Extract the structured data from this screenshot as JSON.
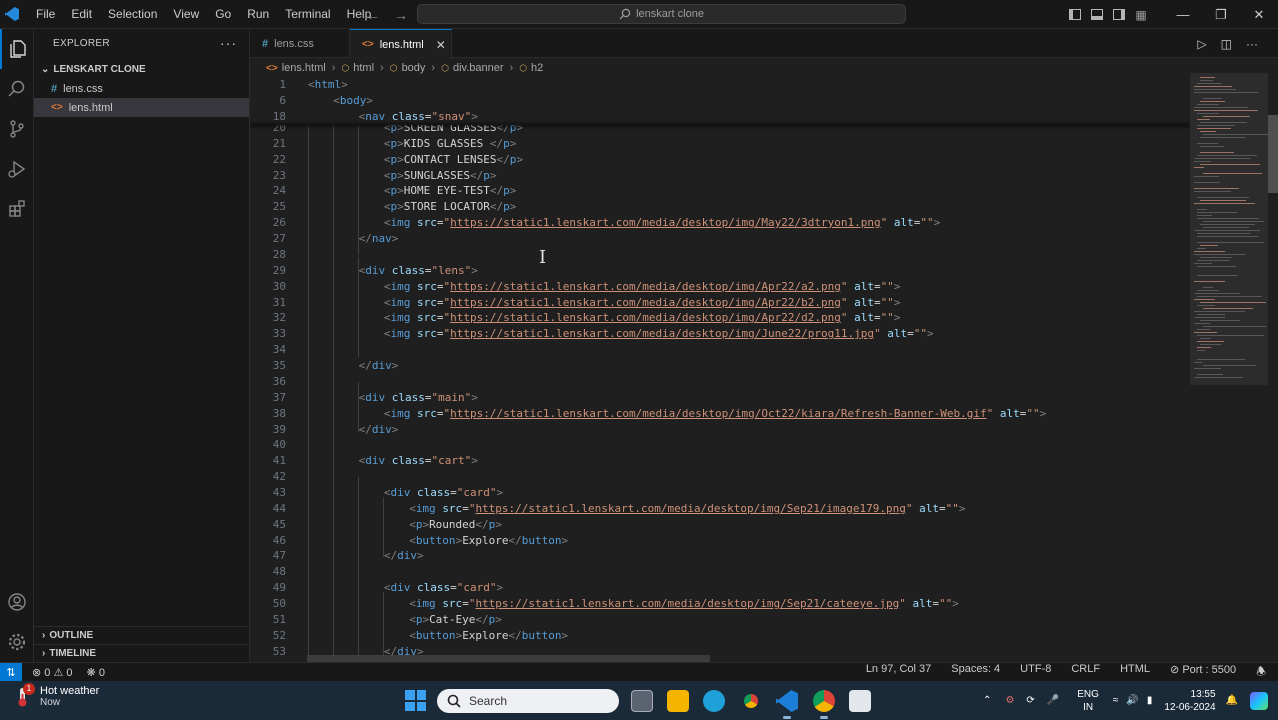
{
  "titlebar": {
    "menu": [
      "File",
      "Edit",
      "Selection",
      "View",
      "Go",
      "Run",
      "Terminal",
      "Help"
    ],
    "search_text": "lenskart clone"
  },
  "sidebar": {
    "title": "EXPLORER",
    "folder": "LENSKART CLONE",
    "files": [
      "lens.css",
      "lens.html"
    ],
    "outline": "OUTLINE",
    "timeline": "TIMELINE"
  },
  "tabs": [
    {
      "label": "lens.css",
      "icon": "css-file-icon"
    },
    {
      "label": "lens.html",
      "icon": "html-file-icon"
    }
  ],
  "breadcrumb": [
    "lens.html",
    "html",
    "body",
    "div.banner",
    "h2"
  ],
  "code_lines": [
    {
      "n": "1",
      "indent": 0,
      "parts": [
        [
          "b",
          "<"
        ],
        [
          "t",
          "html"
        ],
        [
          "b",
          ">"
        ]
      ]
    },
    {
      "n": "6",
      "indent": 1,
      "parts": [
        [
          "b",
          "<"
        ],
        [
          "t",
          "body"
        ],
        [
          "b",
          ">"
        ]
      ]
    },
    {
      "n": "18",
      "indent": 2,
      "parts": [
        [
          "b",
          "<"
        ],
        [
          "t",
          "nav"
        ],
        [
          "tx",
          " "
        ],
        [
          "a",
          "class"
        ],
        [
          "tx",
          "="
        ],
        [
          "s",
          "\"snav\""
        ],
        [
          "b",
          ">"
        ]
      ]
    },
    {
      "n": "20",
      "indent": 3,
      "parts": [
        [
          "b",
          "<"
        ],
        [
          "t",
          "p"
        ],
        [
          "b",
          ">"
        ],
        [
          "tx",
          "SCREEN GLASSES"
        ],
        [
          "b",
          "</"
        ],
        [
          "t",
          "p"
        ],
        [
          "b",
          ">"
        ]
      ]
    },
    {
      "n": "21",
      "indent": 3,
      "parts": [
        [
          "b",
          "<"
        ],
        [
          "t",
          "p"
        ],
        [
          "b",
          ">"
        ],
        [
          "tx",
          "KIDS GLASSES "
        ],
        [
          "b",
          "</"
        ],
        [
          "t",
          "p"
        ],
        [
          "b",
          ">"
        ]
      ]
    },
    {
      "n": "22",
      "indent": 3,
      "parts": [
        [
          "b",
          "<"
        ],
        [
          "t",
          "p"
        ],
        [
          "b",
          ">"
        ],
        [
          "tx",
          "CONTACT LENSES"
        ],
        [
          "b",
          "</"
        ],
        [
          "t",
          "p"
        ],
        [
          "b",
          ">"
        ]
      ]
    },
    {
      "n": "23",
      "indent": 3,
      "parts": [
        [
          "b",
          "<"
        ],
        [
          "t",
          "p"
        ],
        [
          "b",
          ">"
        ],
        [
          "tx",
          "SUNGLASSES"
        ],
        [
          "b",
          "</"
        ],
        [
          "t",
          "p"
        ],
        [
          "b",
          ">"
        ]
      ]
    },
    {
      "n": "24",
      "indent": 3,
      "parts": [
        [
          "b",
          "<"
        ],
        [
          "t",
          "p"
        ],
        [
          "b",
          ">"
        ],
        [
          "tx",
          "HOME EYE-TEST"
        ],
        [
          "b",
          "</"
        ],
        [
          "t",
          "p"
        ],
        [
          "b",
          ">"
        ]
      ]
    },
    {
      "n": "25",
      "indent": 3,
      "parts": [
        [
          "b",
          "<"
        ],
        [
          "t",
          "p"
        ],
        [
          "b",
          ">"
        ],
        [
          "tx",
          "STORE LOCATOR"
        ],
        [
          "b",
          "</"
        ],
        [
          "t",
          "p"
        ],
        [
          "b",
          ">"
        ]
      ]
    },
    {
      "n": "26",
      "indent": 3,
      "parts": [
        [
          "b",
          "<"
        ],
        [
          "t",
          "img"
        ],
        [
          "tx",
          " "
        ],
        [
          "a",
          "src"
        ],
        [
          "tx",
          "="
        ],
        [
          "s",
          "\""
        ],
        [
          "u",
          "https://static1.lenskart.com/media/desktop/img/May22/3dtryon1.png"
        ],
        [
          "s",
          "\""
        ],
        [
          "tx",
          " "
        ],
        [
          "a",
          "alt"
        ],
        [
          "tx",
          "="
        ],
        [
          "s",
          "\"\""
        ],
        [
          "b",
          ">"
        ]
      ]
    },
    {
      "n": "27",
      "indent": 2,
      "parts": [
        [
          "b",
          "</"
        ],
        [
          "t",
          "nav"
        ],
        [
          "b",
          ">"
        ]
      ]
    },
    {
      "n": "28",
      "indent": 0,
      "parts": []
    },
    {
      "n": "29",
      "indent": 2,
      "parts": [
        [
          "b",
          "<"
        ],
        [
          "t",
          "div"
        ],
        [
          "tx",
          " "
        ],
        [
          "a",
          "class"
        ],
        [
          "tx",
          "="
        ],
        [
          "s",
          "\"lens\""
        ],
        [
          "b",
          ">"
        ]
      ]
    },
    {
      "n": "30",
      "indent": 3,
      "parts": [
        [
          "b",
          "<"
        ],
        [
          "t",
          "img"
        ],
        [
          "tx",
          " "
        ],
        [
          "a",
          "src"
        ],
        [
          "tx",
          "="
        ],
        [
          "s",
          "\""
        ],
        [
          "u",
          "https://static1.lenskart.com/media/desktop/img/Apr22/a2.png"
        ],
        [
          "s",
          "\""
        ],
        [
          "tx",
          " "
        ],
        [
          "a",
          "alt"
        ],
        [
          "tx",
          "="
        ],
        [
          "s",
          "\"\""
        ],
        [
          "b",
          ">"
        ]
      ]
    },
    {
      "n": "31",
      "indent": 3,
      "parts": [
        [
          "b",
          "<"
        ],
        [
          "t",
          "img"
        ],
        [
          "tx",
          " "
        ],
        [
          "a",
          "src"
        ],
        [
          "tx",
          "="
        ],
        [
          "s",
          "\""
        ],
        [
          "u",
          "https://static1.lenskart.com/media/desktop/img/Apr22/b2.png"
        ],
        [
          "s",
          "\""
        ],
        [
          "tx",
          " "
        ],
        [
          "a",
          "alt"
        ],
        [
          "tx",
          "="
        ],
        [
          "s",
          "\"\""
        ],
        [
          "b",
          ">"
        ]
      ]
    },
    {
      "n": "32",
      "indent": 3,
      "parts": [
        [
          "b",
          "<"
        ],
        [
          "t",
          "img"
        ],
        [
          "tx",
          " "
        ],
        [
          "a",
          "src"
        ],
        [
          "tx",
          "="
        ],
        [
          "s",
          "\""
        ],
        [
          "u",
          "https://static1.lenskart.com/media/desktop/img/Apr22/d2.png"
        ],
        [
          "s",
          "\""
        ],
        [
          "tx",
          " "
        ],
        [
          "a",
          "alt"
        ],
        [
          "tx",
          "="
        ],
        [
          "s",
          "\"\""
        ],
        [
          "b",
          ">"
        ]
      ]
    },
    {
      "n": "33",
      "indent": 3,
      "parts": [
        [
          "b",
          "<"
        ],
        [
          "t",
          "img"
        ],
        [
          "tx",
          " "
        ],
        [
          "a",
          "src"
        ],
        [
          "tx",
          "="
        ],
        [
          "s",
          "\""
        ],
        [
          "u",
          "https://static1.lenskart.com/media/desktop/img/June22/prog11.jpg"
        ],
        [
          "s",
          "\""
        ],
        [
          "tx",
          " "
        ],
        [
          "a",
          "alt"
        ],
        [
          "tx",
          "="
        ],
        [
          "s",
          "\"\""
        ],
        [
          "b",
          ">"
        ]
      ]
    },
    {
      "n": "34",
      "indent": 0,
      "parts": []
    },
    {
      "n": "35",
      "indent": 2,
      "parts": [
        [
          "b",
          "</"
        ],
        [
          "t",
          "div"
        ],
        [
          "b",
          ">"
        ]
      ]
    },
    {
      "n": "36",
      "indent": 0,
      "parts": []
    },
    {
      "n": "37",
      "indent": 2,
      "parts": [
        [
          "b",
          "<"
        ],
        [
          "t",
          "div"
        ],
        [
          "tx",
          " "
        ],
        [
          "a",
          "class"
        ],
        [
          "tx",
          "="
        ],
        [
          "s",
          "\"main\""
        ],
        [
          "b",
          ">"
        ]
      ]
    },
    {
      "n": "38",
      "indent": 3,
      "parts": [
        [
          "b",
          "<"
        ],
        [
          "t",
          "img"
        ],
        [
          "tx",
          " "
        ],
        [
          "a",
          "src"
        ],
        [
          "tx",
          "="
        ],
        [
          "s",
          "\""
        ],
        [
          "u",
          "https://static1.lenskart.com/media/desktop/img/Oct22/kiara/Refresh-Banner-Web.gif"
        ],
        [
          "s",
          "\""
        ],
        [
          "tx",
          " "
        ],
        [
          "a",
          "alt"
        ],
        [
          "tx",
          "="
        ],
        [
          "s",
          "\"\""
        ],
        [
          "b",
          ">"
        ]
      ]
    },
    {
      "n": "39",
      "indent": 2,
      "parts": [
        [
          "b",
          "</"
        ],
        [
          "t",
          "div"
        ],
        [
          "b",
          ">"
        ]
      ]
    },
    {
      "n": "40",
      "indent": 0,
      "parts": []
    },
    {
      "n": "41",
      "indent": 2,
      "parts": [
        [
          "b",
          "<"
        ],
        [
          "t",
          "div"
        ],
        [
          "tx",
          " "
        ],
        [
          "a",
          "class"
        ],
        [
          "tx",
          "="
        ],
        [
          "s",
          "\"cart\""
        ],
        [
          "b",
          ">"
        ]
      ]
    },
    {
      "n": "42",
      "indent": 0,
      "parts": []
    },
    {
      "n": "43",
      "indent": 3,
      "parts": [
        [
          "b",
          "<"
        ],
        [
          "t",
          "div"
        ],
        [
          "tx",
          " "
        ],
        [
          "a",
          "class"
        ],
        [
          "tx",
          "="
        ],
        [
          "s",
          "\"card\""
        ],
        [
          "b",
          ">"
        ]
      ]
    },
    {
      "n": "44",
      "indent": 4,
      "parts": [
        [
          "b",
          "<"
        ],
        [
          "t",
          "img"
        ],
        [
          "tx",
          " "
        ],
        [
          "a",
          "src"
        ],
        [
          "tx",
          "="
        ],
        [
          "s",
          "\""
        ],
        [
          "u",
          "https://static1.lenskart.com/media/desktop/img/Sep21/image179.png"
        ],
        [
          "s",
          "\""
        ],
        [
          "tx",
          " "
        ],
        [
          "a",
          "alt"
        ],
        [
          "tx",
          "="
        ],
        [
          "s",
          "\"\""
        ],
        [
          "b",
          ">"
        ]
      ]
    },
    {
      "n": "45",
      "indent": 4,
      "parts": [
        [
          "b",
          "<"
        ],
        [
          "t",
          "p"
        ],
        [
          "b",
          ">"
        ],
        [
          "tx",
          "Rounded"
        ],
        [
          "b",
          "</"
        ],
        [
          "t",
          "p"
        ],
        [
          "b",
          ">"
        ]
      ]
    },
    {
      "n": "46",
      "indent": 4,
      "parts": [
        [
          "b",
          "<"
        ],
        [
          "t",
          "button"
        ],
        [
          "b",
          ">"
        ],
        [
          "tx",
          "Explore"
        ],
        [
          "b",
          "</"
        ],
        [
          "t",
          "button"
        ],
        [
          "b",
          ">"
        ]
      ]
    },
    {
      "n": "47",
      "indent": 3,
      "parts": [
        [
          "b",
          "</"
        ],
        [
          "t",
          "div"
        ],
        [
          "b",
          ">"
        ]
      ]
    },
    {
      "n": "48",
      "indent": 0,
      "parts": []
    },
    {
      "n": "49",
      "indent": 3,
      "parts": [
        [
          "b",
          "<"
        ],
        [
          "t",
          "div"
        ],
        [
          "tx",
          " "
        ],
        [
          "a",
          "class"
        ],
        [
          "tx",
          "="
        ],
        [
          "s",
          "\"card\""
        ],
        [
          "b",
          ">"
        ]
      ]
    },
    {
      "n": "50",
      "indent": 4,
      "parts": [
        [
          "b",
          "<"
        ],
        [
          "t",
          "img"
        ],
        [
          "tx",
          " "
        ],
        [
          "a",
          "src"
        ],
        [
          "tx",
          "="
        ],
        [
          "s",
          "\""
        ],
        [
          "u",
          "https://static1.lenskart.com/media/desktop/img/Sep21/cateeye.jpg"
        ],
        [
          "s",
          "\""
        ],
        [
          "tx",
          " "
        ],
        [
          "a",
          "alt"
        ],
        [
          "tx",
          "="
        ],
        [
          "s",
          "\"\""
        ],
        [
          "b",
          ">"
        ]
      ]
    },
    {
      "n": "51",
      "indent": 4,
      "parts": [
        [
          "b",
          "<"
        ],
        [
          "t",
          "p"
        ],
        [
          "b",
          ">"
        ],
        [
          "tx",
          "Cat-Eye"
        ],
        [
          "b",
          "</"
        ],
        [
          "t",
          "p"
        ],
        [
          "b",
          ">"
        ]
      ]
    },
    {
      "n": "52",
      "indent": 4,
      "parts": [
        [
          "b",
          "<"
        ],
        [
          "t",
          "button"
        ],
        [
          "b",
          ">"
        ],
        [
          "tx",
          "Explore"
        ],
        [
          "b",
          "</"
        ],
        [
          "t",
          "button"
        ],
        [
          "b",
          ">"
        ]
      ]
    },
    {
      "n": "53",
      "indent": 3,
      "parts": [
        [
          "b",
          "</"
        ],
        [
          "t",
          "div"
        ],
        [
          "b",
          ">"
        ]
      ]
    }
  ],
  "status": {
    "errors": "0",
    "warnings": "0",
    "ports": "0",
    "position": "Ln 97, Col 37",
    "spaces": "Spaces: 4",
    "encoding": "UTF-8",
    "eol": "CRLF",
    "language": "HTML",
    "port": "Port : 5500"
  },
  "taskbar": {
    "weather_title": "Hot weather",
    "weather_sub": "Now",
    "weather_badge": "1",
    "search_placeholder": "Search",
    "lang_line1": "ENG",
    "lang_line2": "IN",
    "time": "13:55",
    "date": "12-06-2024"
  },
  "colors": {
    "accent": "#0078d4",
    "tag": "#569cd6",
    "attribute": "#9cdcfe",
    "string": "#ce9178",
    "taskbar": "#1b2a38"
  }
}
